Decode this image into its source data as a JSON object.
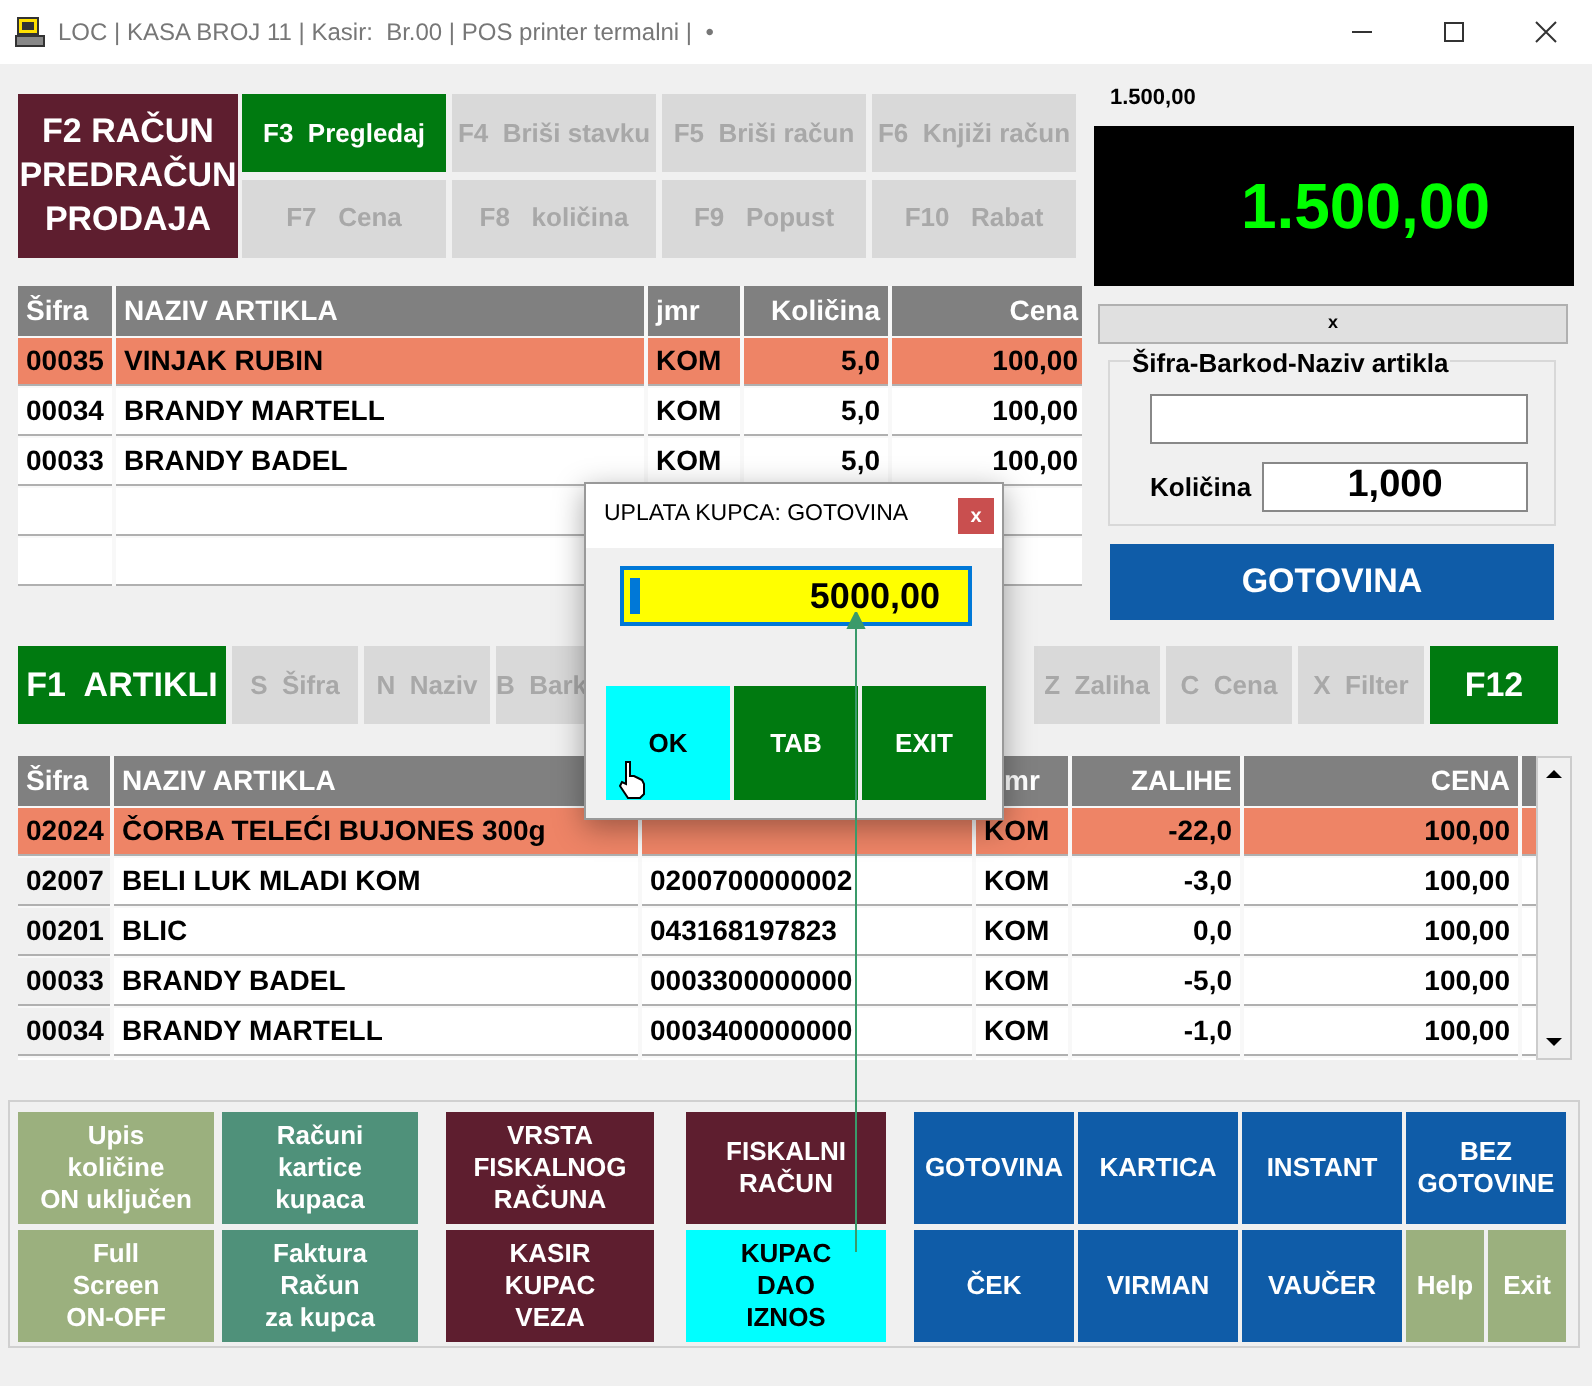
{
  "window": {
    "title": "LOC | KASA BROJ 11 | Kasir:  Br.00 | POS printer termalni |  •"
  },
  "main_button": {
    "label": "F2 RAČUN\nPREDRAČUN\nPRODAJA"
  },
  "function_buttons": [
    {
      "label": "F3  Pregledaj",
      "disabled": false
    },
    {
      "label": "F4  Briši stavku",
      "disabled": true
    },
    {
      "label": "F5  Briši račun",
      "disabled": true
    },
    {
      "label": "F6  Knjiži račun",
      "disabled": true
    },
    {
      "label": "F7   Cena",
      "disabled": true
    },
    {
      "label": "F8   količina",
      "disabled": true
    },
    {
      "label": "F9   Popust",
      "disabled": true
    },
    {
      "label": "F10   Rabat",
      "disabled": true
    }
  ],
  "total_display": {
    "caption": "1.500,00",
    "amount": "1.500,00"
  },
  "status_strip": {
    "text": "x"
  },
  "article_search": {
    "legend": "Šifra-Barkod-Naziv artikla",
    "quantity_label": "Količina",
    "quantity_value": "1,000"
  },
  "pay_button": {
    "label": "GOTOVINA"
  },
  "cart": {
    "columns": [
      "Šifra",
      "NAZIV ARTIKLA",
      "jmr",
      "Količina",
      "Cena"
    ],
    "rows": [
      {
        "cells": [
          "00035",
          "VINJAK RUBIN",
          "KOM",
          "5,0",
          "100,00"
        ],
        "selected": true
      },
      {
        "cells": [
          "00034",
          "BRANDY MARTELL",
          "KOM",
          "5,0",
          "100,00"
        ],
        "selected": false
      },
      {
        "cells": [
          "00033",
          "BRANDY BADEL",
          "KOM",
          "5,0",
          "100,00"
        ],
        "selected": false
      }
    ]
  },
  "article_toolbar": [
    {
      "label": "F1  ARTIKLI",
      "kind": "main"
    },
    {
      "label": "S  Šifra",
      "kind": "filter"
    },
    {
      "label": "N  Naziv",
      "kind": "filter"
    },
    {
      "label": "B  Bark",
      "kind": "filter"
    },
    {
      "label": "Z  Zaliha",
      "kind": "filter"
    },
    {
      "label": "C  Cena",
      "kind": "filter"
    },
    {
      "label": "X  Filter",
      "kind": "filter"
    },
    {
      "label": "F12",
      "kind": "main"
    }
  ],
  "articles": {
    "columns": [
      "Šifra",
      "NAZIV ARTIKLA",
      "",
      "mr",
      "ZALIHE",
      "CENA"
    ],
    "rows": [
      {
        "cells": [
          "02024",
          "ČORBA TELEĆI BUJONES 300g",
          "",
          "KOM",
          "-22,0",
          "100,00"
        ],
        "selected": true
      },
      {
        "cells": [
          "02007",
          "BELI LUK MLADI KOM",
          "0200700000002",
          "KOM",
          "-3,0",
          "100,00"
        ],
        "selected": false
      },
      {
        "cells": [
          "00201",
          "BLIC",
          "043168197823",
          "KOM",
          "0,0",
          "100,00"
        ],
        "selected": false
      },
      {
        "cells": [
          "00033",
          "BRANDY BADEL",
          "0003300000000",
          "KOM",
          "-5,0",
          "100,00"
        ],
        "selected": false
      },
      {
        "cells": [
          "00034",
          "BRANDY MARTELL",
          "0003400000000",
          "KOM",
          "-1,0",
          "100,00"
        ],
        "selected": false
      }
    ]
  },
  "bottom_buttons": [
    {
      "label": "Upis\nkoličine\nON uključen",
      "color": "#9bb07e"
    },
    {
      "label": "Računi\nkartice\nkupaca",
      "color": "#4f917a"
    },
    {
      "label": "VRSTA\nFISKALNOG\nRAČUNA",
      "color": "#5e1e2f"
    },
    {
      "label": "FISKALNI\nRAČUN",
      "color": "#5e1e2f"
    },
    {
      "label": "GOTOVINA",
      "color": "#0f5ca8"
    },
    {
      "label": "KARTICA",
      "color": "#0f5ca8"
    },
    {
      "label": "INSTANT",
      "color": "#0f5ca8"
    },
    {
      "label": "BEZ\nGOTOVINE",
      "color": "#0f5ca8"
    },
    {
      "label": "Full\nScreen\nON-OFF",
      "color": "#9bb07e"
    },
    {
      "label": "Faktura\nRačun\nza kupca",
      "color": "#4f917a"
    },
    {
      "label": "KASIR\nKUPAC\nVEZA",
      "color": "#5e1e2f"
    },
    {
      "label": "KUPAC\nDAO\nIZNOS",
      "color": "#00ffff"
    },
    {
      "label": "ČEK",
      "color": "#0f5ca8"
    },
    {
      "label": "VIRMAN",
      "color": "#0f5ca8"
    },
    {
      "label": "VAUČER",
      "color": "#0f5ca8"
    },
    {
      "label": "Help",
      "color": "#9bb07e"
    },
    {
      "label": "Exit",
      "color": "#9bb07e"
    }
  ],
  "payment_dialog": {
    "title": "UPLATA KUPCA: GOTOVINA",
    "close": "x",
    "amount": "5000,00",
    "buttons": [
      {
        "label": "OK",
        "selected": true
      },
      {
        "label": "TAB",
        "selected": false
      },
      {
        "label": "EXIT",
        "selected": false
      }
    ]
  }
}
